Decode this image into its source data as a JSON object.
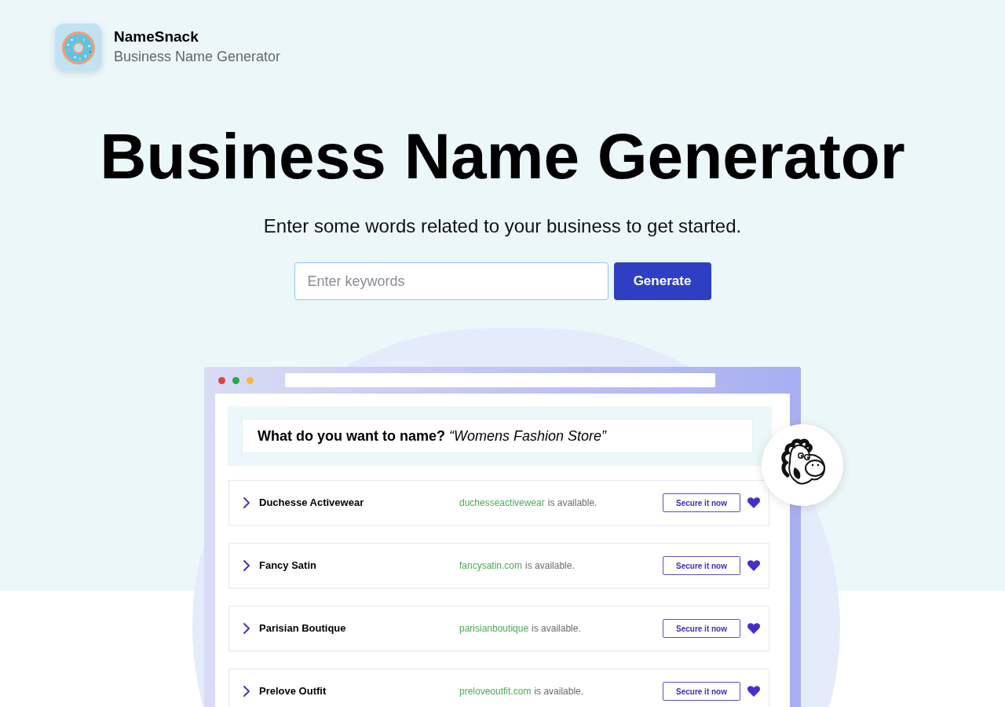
{
  "brand": {
    "name": "NameSnack",
    "tagline": "Business Name Generator"
  },
  "hero": {
    "title": "Business Name Generator",
    "subtitle": "Enter some words related to your business to get started."
  },
  "search": {
    "placeholder": "Enter keywords",
    "button": "Generate"
  },
  "preview": {
    "prompt": "**What do you want to name?** *“Womens Fashion Store”*",
    "results": [
      {
        "name": "Duchesse Activewear",
        "domain": "duchesseactivewear",
        "status": "is available.",
        "button": "Secure it now"
      },
      {
        "name": "Fancy Satin",
        "domain": "fancysatin.com",
        "status": "is available.",
        "button": "Secure it now"
      },
      {
        "name": "Parisian Boutique",
        "domain": "parisianboutique",
        "status": "is available.",
        "button": "Secure it now"
      },
      {
        "name": "Prelove Outfit",
        "domain": "preloveoutfit.com",
        "status": "is available.",
        "button": "Secure it now"
      }
    ]
  }
}
